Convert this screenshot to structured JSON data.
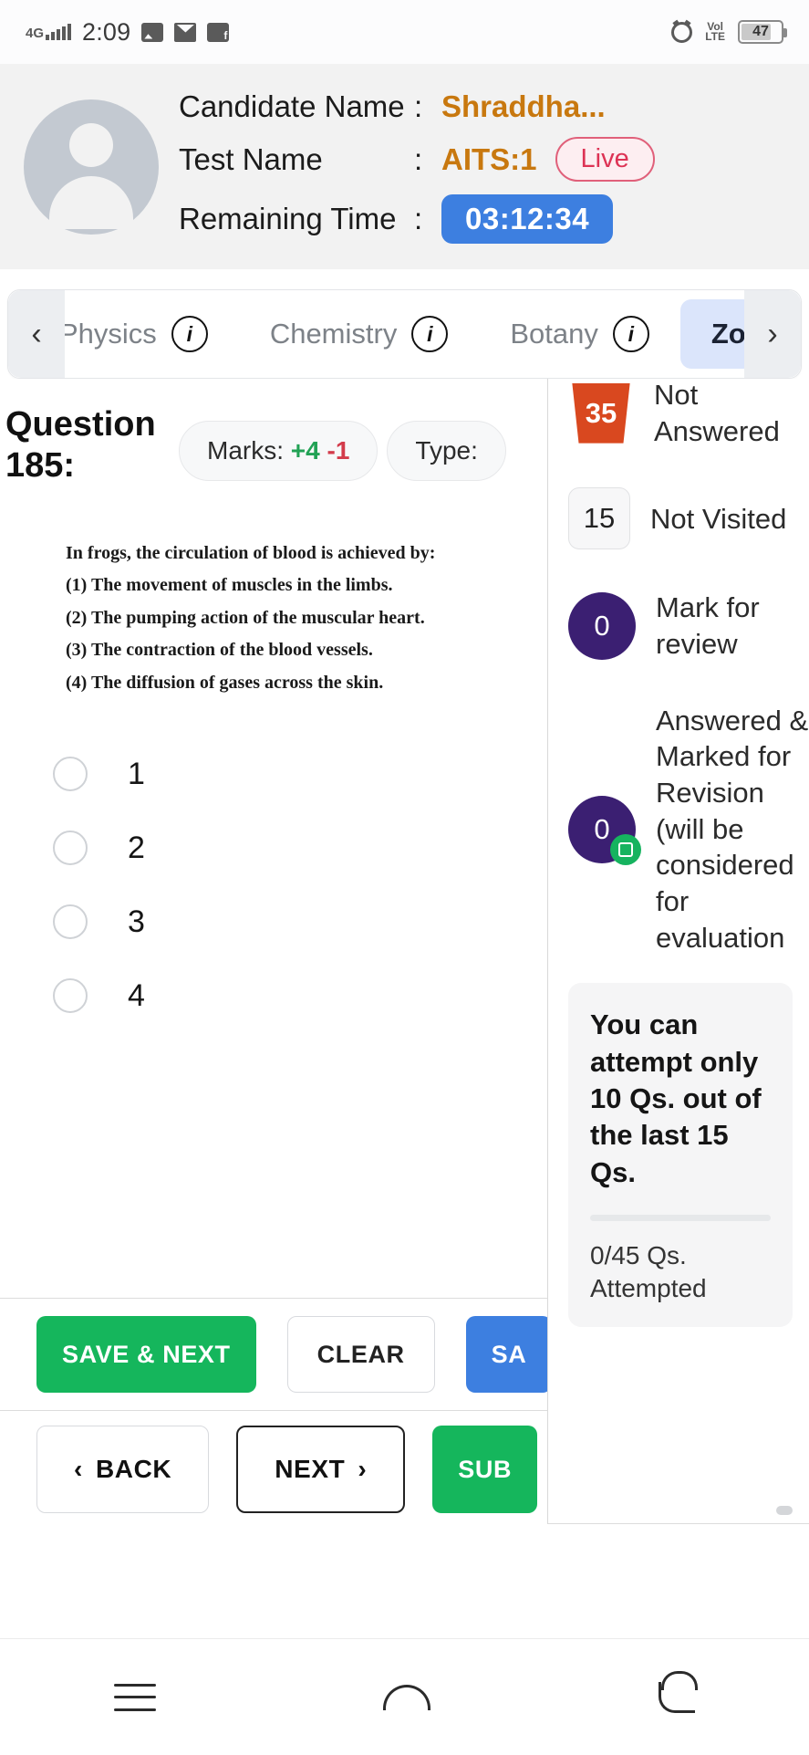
{
  "statusbar": {
    "network": "4G",
    "time": "2:09",
    "volte": "VoLTE",
    "battery": "47",
    "icons": [
      "photo-icon",
      "mail-icon",
      "app-icon",
      "alarm-icon",
      "volte-icon",
      "battery-icon"
    ]
  },
  "header": {
    "rows": [
      {
        "label": "Candidate Name",
        "colon": ":",
        "value": "Shraddha..."
      },
      {
        "label": "Test Name",
        "colon": ":",
        "value": "AITS:1",
        "badge": "Live"
      },
      {
        "label": "Remaining Time",
        "colon": ":",
        "value": "03:12:34"
      }
    ]
  },
  "tabs": {
    "left_arrow": "‹",
    "right_arrow": "›",
    "items": [
      {
        "label": "Physics",
        "info": "i",
        "active": false
      },
      {
        "label": "Chemistry",
        "info": "i",
        "active": false
      },
      {
        "label": "Botany",
        "info": "i",
        "active": false
      },
      {
        "label": "Zo",
        "info": "i",
        "active": true
      }
    ]
  },
  "question": {
    "title_line1": "Question",
    "title_line2": "185:",
    "marks_label": "Marks:",
    "marks_positive": "+4",
    "marks_negative": "-1",
    "type_label": "Type:",
    "stem": "In frogs, the circulation of blood is achieved by:",
    "choices": [
      "(1) The movement of muscles in the limbs.",
      "(2) The pumping action of the muscular heart.",
      "(3) The contraction of the blood vessels.",
      "(4) The diffusion of gases across the skin."
    ],
    "options": [
      "1",
      "2",
      "3",
      "4"
    ]
  },
  "actions": {
    "save_next": "SAVE & NEXT",
    "clear": "CLEAR",
    "save_partial": "SA",
    "back": "BACK",
    "back_arrow": "‹",
    "next": "NEXT",
    "next_arrow": "›",
    "submit": "SUB"
  },
  "sidebar": {
    "legend": [
      {
        "count": "35",
        "label": "Not Answered",
        "shape": "trapezoid",
        "color": "#d9481f"
      },
      {
        "count": "15",
        "label": "Not Visited",
        "shape": "square",
        "color": "#f7f7f8"
      },
      {
        "count": "0",
        "label": "Mark for review",
        "shape": "circle",
        "color": "#3b1f72"
      },
      {
        "count": "0",
        "label": "Answered & Marked for Revision (will be considered for evaluation",
        "shape": "circle-badge",
        "color": "#3b1f72"
      }
    ],
    "infobox": {
      "title": "You can attempt only 10 Qs. out of the last 15 Qs.",
      "attempted": "0/45 Qs. Attempted"
    }
  },
  "navbar": {
    "items": [
      "menu-icon",
      "home-icon",
      "back-icon"
    ]
  }
}
